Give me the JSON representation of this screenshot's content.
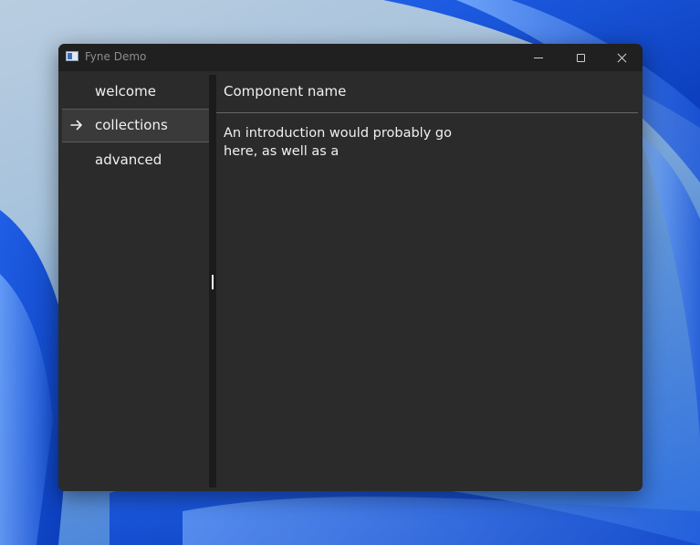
{
  "window": {
    "title": "Fyne Demo",
    "colors": {
      "background": "#2b2b2b",
      "titlebar": "#202020",
      "selected_row": "#3a3a3a",
      "text": "#f0f0f0"
    }
  },
  "titlebar_buttons": {
    "minimize_icon": "minimize-icon",
    "maximize_icon": "maximize-icon",
    "close_icon": "close-icon"
  },
  "sidebar": {
    "items": [
      {
        "label": "welcome",
        "selected": false
      },
      {
        "label": "collections",
        "selected": true,
        "icon": "arrow-right-icon"
      },
      {
        "label": "advanced",
        "selected": false
      }
    ]
  },
  "content": {
    "title": "Component name",
    "body": "An introduction would probably go here, as well as a"
  }
}
